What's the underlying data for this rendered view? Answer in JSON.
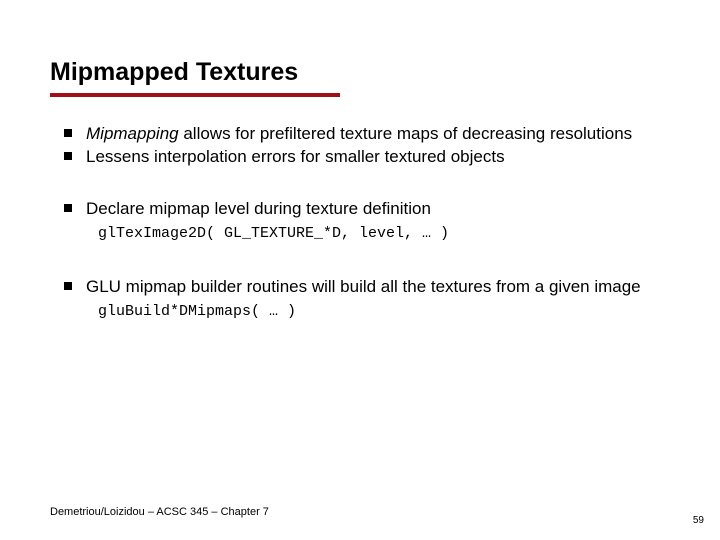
{
  "title": "Mipmapped Textures",
  "bullets": {
    "b1_prefix_italic": "Mipmapping",
    "b1_rest": " allows for prefiltered texture maps of decreasing resolutions",
    "b2": "Lessens interpolation errors for smaller textured objects",
    "b3": "Declare mipmap level during texture definition",
    "b3_code": "glTexImage2D( GL_TEXTURE_*D, level, … )",
    "b4": "GLU mipmap builder routines will build all the textures from a given image",
    "b4_code": "gluBuild*DMipmaps( … )"
  },
  "footer_left": "Demetriou/Loizidou – ACSC 345 – Chapter 7",
  "footer_right": "59"
}
